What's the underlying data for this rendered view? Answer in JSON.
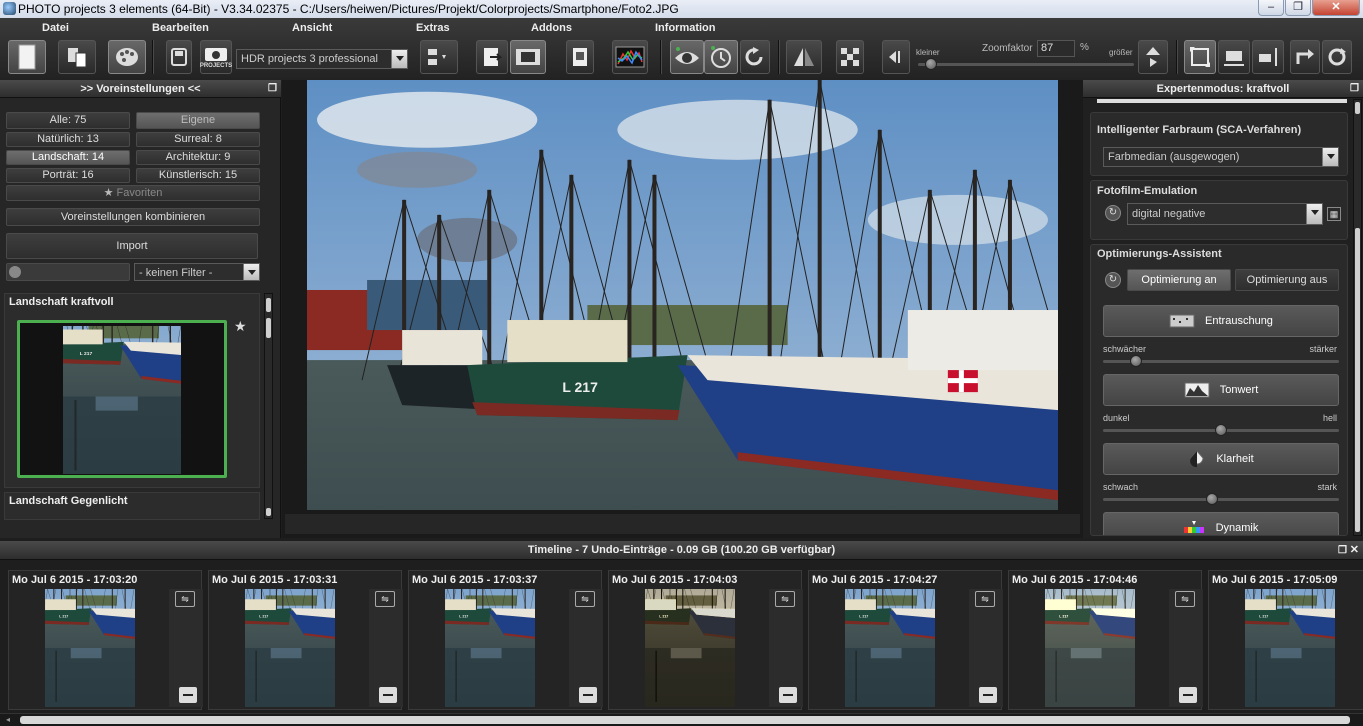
{
  "window": {
    "title": "PHOTO projects 3 elements (64-Bit) - V3.34.02375 - C:/Users/heiwen/Pictures/Projekt/Colorprojects/Smartphone/Foto2.JPG",
    "minimize": "–",
    "maximize": "❐",
    "close": "✕"
  },
  "menu": {
    "datei": "Datei",
    "bearbeiten": "Bearbeiten",
    "ansicht": "Ansicht",
    "extras": "Extras",
    "addons": "Addons",
    "information": "Information"
  },
  "toolbar": {
    "projects_label": "PROJECTS",
    "hdr_combo": "HDR projects 3 professional",
    "zoom_small": "kleiner",
    "zoom_label": "Zoomfaktor",
    "zoom_value": "87",
    "zoom_unit": "%",
    "zoom_large": "größer",
    "zoom_level": 0.06
  },
  "left_panel": {
    "header": ">> Voreinstellungen <<",
    "categories": [
      {
        "label": "Alle: 75",
        "active": false
      },
      {
        "label": "Eigene",
        "active": true
      },
      {
        "label": "Natürlich: 13",
        "active": false
      },
      {
        "label": "Surreal: 8",
        "active": false
      },
      {
        "label": "Landschaft: 14",
        "active": true
      },
      {
        "label": "Architektur: 9",
        "active": false
      },
      {
        "label": "Porträt: 16",
        "active": false
      },
      {
        "label": "Künstlerisch: 15",
        "active": false
      }
    ],
    "favorites": "Favoriten",
    "combine": "Voreinstellungen kombinieren",
    "import": "Import",
    "filter": "- keinen Filter -",
    "preset1": "Landschaft kraftvoll",
    "preset2": "Landschaft Gegenlicht"
  },
  "right_panel": {
    "header": "Expertenmodus: kraftvoll",
    "sca_title": "Intelligenter Farbraum (SCA-Verfahren)",
    "sca_value": "Farbmedian (ausgewogen)",
    "film_title": "Fotofilm-Emulation",
    "film_value": "digital negative",
    "opt_title": "Optimierungs-Assistent",
    "opt_on": "Optimierung an",
    "opt_off": "Optimierung aus",
    "noise_btn": "Entrauschung",
    "noise_min": "schwächer",
    "noise_max": "stärker",
    "noise_level": 0.14,
    "tone_btn": "Tonwert",
    "tone_min": "dunkel",
    "tone_max": "hell",
    "tone_level": 0.5,
    "clarity_btn": "Klarheit",
    "clarity_min": "schwach",
    "clarity_max": "stark",
    "clarity_level": 0.46,
    "dynamic_btn": "Dynamik"
  },
  "timeline": {
    "header": "Timeline - 7 Undo-Einträge - 0.09 GB (100.20 GB verfügbar)",
    "entries": [
      {
        "time": "Mo Jul 6 2015 - 17:03:20",
        "tone": "normal"
      },
      {
        "time": "Mo Jul 6 2015 - 17:03:31",
        "tone": "normal"
      },
      {
        "time": "Mo Jul 6 2015 - 17:03:37",
        "tone": "normal"
      },
      {
        "time": "Mo Jul 6 2015 - 17:04:03",
        "tone": "sepia"
      },
      {
        "time": "Mo Jul 6 2015 - 17:04:27",
        "tone": "normal"
      },
      {
        "time": "Mo Jul 6 2015 - 17:04:46",
        "tone": "warm"
      },
      {
        "time": "Mo Jul 6 2015 - 17:05:09",
        "tone": "normal"
      }
    ]
  },
  "colors": {
    "accent_green": "#4caf50",
    "hull_blue": "#1f3f86",
    "hull_green": "#1e4a3c",
    "sky": "#7fa6cf"
  }
}
